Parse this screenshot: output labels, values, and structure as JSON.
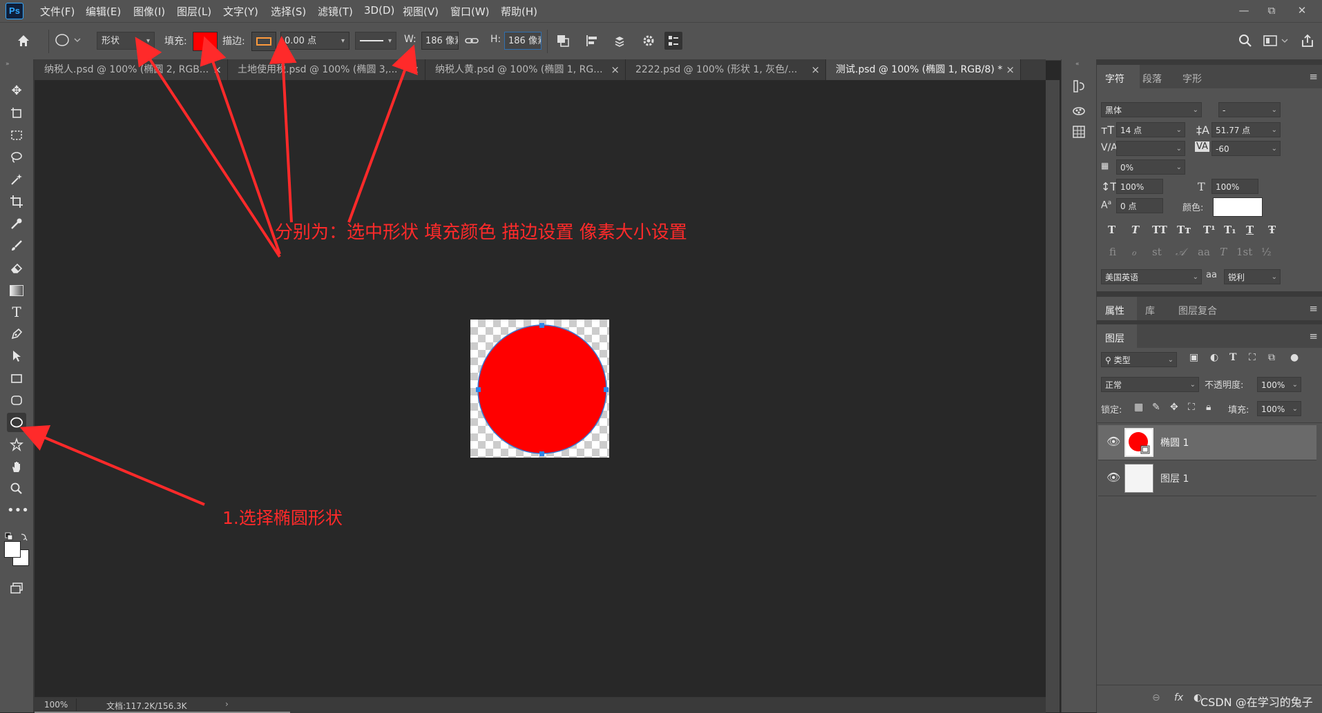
{
  "app": {
    "logo": "Ps"
  },
  "menu": [
    "文件(F)",
    "编辑(E)",
    "图像(I)",
    "图层(L)",
    "文字(Y)",
    "选择(S)",
    "滤镜(T)",
    "3D(D)",
    "视图(V)",
    "窗口(W)",
    "帮助(H)"
  ],
  "window_controls": {
    "minimize": "—",
    "restore": "⧉",
    "close": "✕"
  },
  "options": {
    "mode_value": "形状",
    "fill_label": "填充:",
    "fill_color": "#ff0000",
    "stroke_label": "描边:",
    "stroke_width": "0.00 点",
    "w_label": "W:",
    "w_value": "186 像素",
    "h_label": "H:",
    "h_value": "186 像素"
  },
  "tabs": [
    {
      "label": "纳税人.psd @ 100% (椭圆 2, RGB..."
    },
    {
      "label": "土地使用税.psd @ 100% (椭圆 3,..."
    },
    {
      "label": "纳税人黄.psd @ 100% (椭圆 1, RG..."
    },
    {
      "label": "2222.psd @ 100% (形状 1, 灰色/..."
    },
    {
      "label": "测试.psd @ 100% (椭圆 1, RGB/8) *"
    }
  ],
  "shape": {
    "fill": "#ff0000",
    "stroke": "#3a78d0",
    "handle_color": "#2f86e8"
  },
  "status": {
    "zoom": "100%",
    "doc": "文档:117.2K/156.3K"
  },
  "char_panel": {
    "tabs": [
      "字符",
      "段落",
      "字形"
    ],
    "font_family": "黑体",
    "font_style": "-",
    "size": "14 点",
    "leading": "51.77 点",
    "kerning": "",
    "tracking": "-60",
    "scale_pct": "0%",
    "vscale": "100%",
    "hscale": "100%",
    "baseline": "0 点",
    "color_label": "颜色:",
    "color": "#ffffff",
    "language": "美国英语",
    "aa_label": "aa",
    "antialias": "锐利",
    "style_buttons": [
      "T",
      "T",
      "TT",
      "Tт",
      "T¹",
      "T₁",
      "T",
      "Ŧ"
    ],
    "ot_buttons": [
      "ﬁ",
      "ℴ",
      "st",
      "𝒜",
      "aa",
      "T",
      "1st",
      "½"
    ]
  },
  "props_panel": {
    "tabs": [
      "属性",
      "库",
      "图层复合"
    ]
  },
  "layers_panel": {
    "title": "图层",
    "filter_kind": "类型",
    "blend_mode": "正常",
    "opacity_label": "不透明度:",
    "opacity": "100%",
    "lock_label": "锁定:",
    "fill_label": "填充:",
    "fill": "100%",
    "layers": [
      {
        "name": "椭圆 1"
      },
      {
        "name": "图层 1"
      }
    ],
    "footer": [
      "fx",
      "◐"
    ]
  },
  "watermark": "CSDN @在学习的兔子",
  "annotations": {
    "top": "分别为：选中形状 填充颜色 描边设置 像素大小设置",
    "left": "1.选择椭圆形状"
  }
}
